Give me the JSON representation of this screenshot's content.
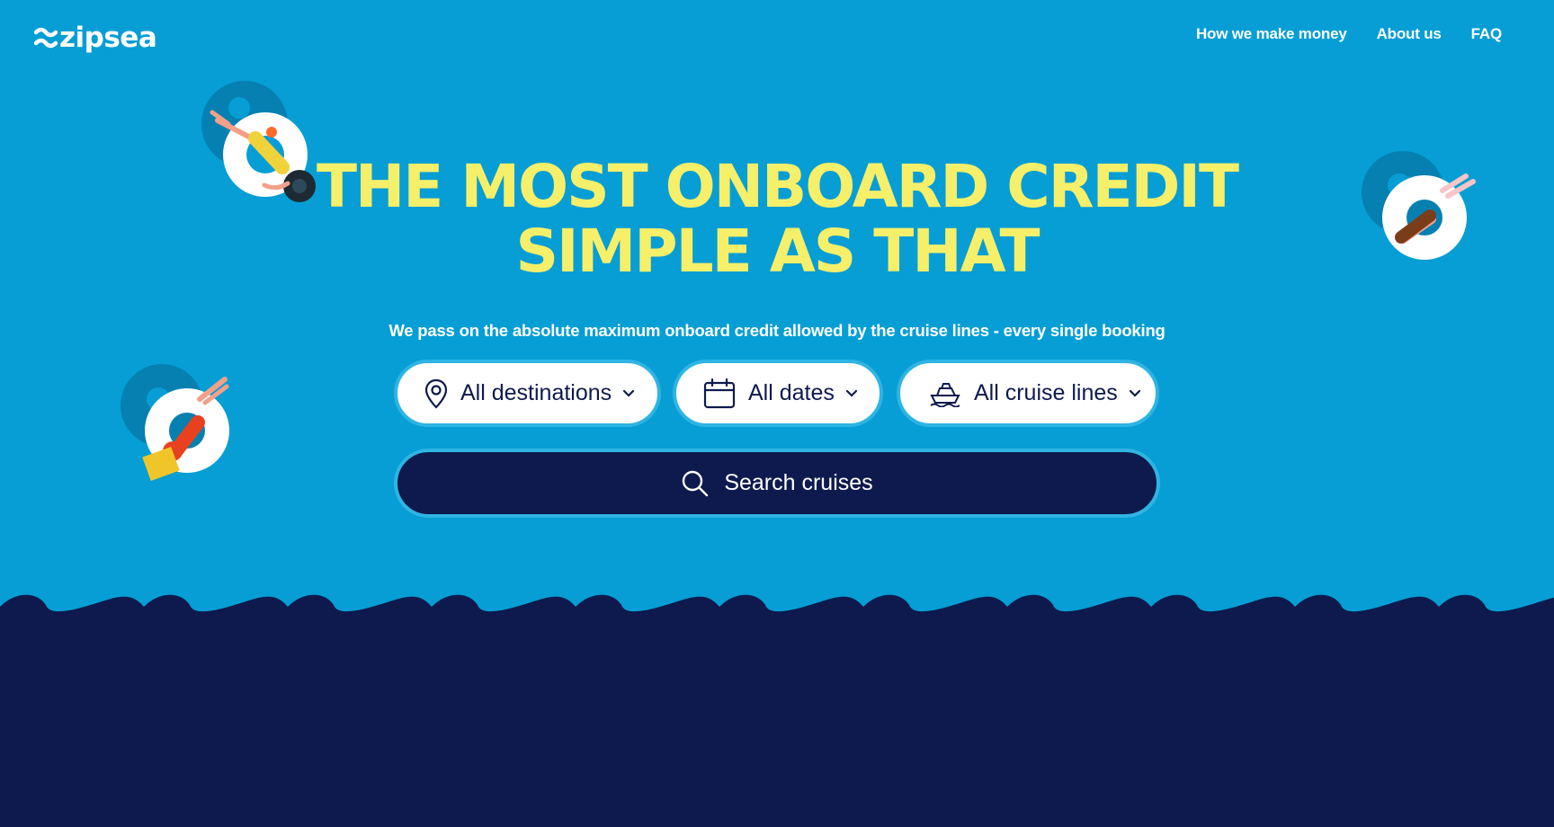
{
  "brand": {
    "name": "zipsea"
  },
  "nav": {
    "items": [
      "How we make money",
      "About us",
      "FAQ"
    ]
  },
  "hero": {
    "headline_line1": "THE MOST ONBOARD CREDIT",
    "headline_line2": "SIMPLE AS THAT",
    "subtitle": "We pass on the absolute maximum onboard credit allowed by the cruise lines - every single booking"
  },
  "filters": {
    "destinations": {
      "label": "All destinations",
      "icon": "map-pin-icon"
    },
    "dates": {
      "label": "All dates",
      "icon": "calendar-icon"
    },
    "cruise_lines": {
      "label": "All cruise lines",
      "icon": "ship-icon"
    }
  },
  "search": {
    "label": "Search cruises",
    "icon": "search-icon"
  },
  "colors": {
    "sky": "#069ed4",
    "navy": "#0e1a4d",
    "headline": "#f6ef6a",
    "pill_border": "#2fb4e3"
  }
}
